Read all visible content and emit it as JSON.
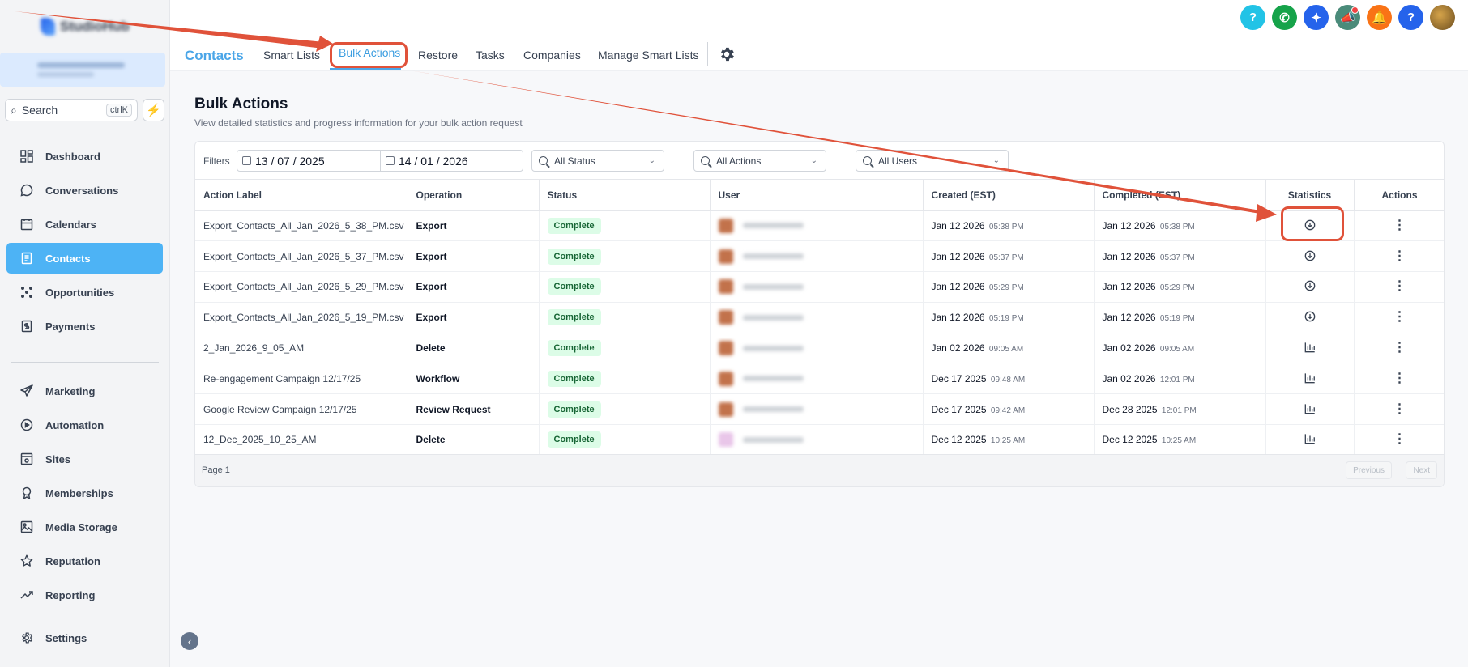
{
  "sidebar": {
    "logo_text": "StudioHub",
    "search": {
      "label": "Search",
      "shortcut": "ctrlK"
    },
    "items": [
      {
        "label": "Dashboard",
        "icon": "dashboard-icon"
      },
      {
        "label": "Conversations",
        "icon": "chat-icon"
      },
      {
        "label": "Calendars",
        "icon": "calendar-icon"
      },
      {
        "label": "Contacts",
        "icon": "contacts-icon",
        "active": true
      },
      {
        "label": "Opportunities",
        "icon": "opportunities-icon"
      },
      {
        "label": "Payments",
        "icon": "payments-icon"
      },
      {
        "label": "Marketing",
        "icon": "send-icon"
      },
      {
        "label": "Automation",
        "icon": "automation-icon"
      },
      {
        "label": "Sites",
        "icon": "sites-icon"
      },
      {
        "label": "Memberships",
        "icon": "award-icon"
      },
      {
        "label": "Media Storage",
        "icon": "image-icon"
      },
      {
        "label": "Reputation",
        "icon": "star-icon"
      },
      {
        "label": "Reporting",
        "icon": "trend-icon"
      },
      {
        "label": "Settings",
        "icon": "gear-icon"
      }
    ]
  },
  "topbar": {
    "icons": [
      {
        "name": "help-icon",
        "glyph": "?",
        "color": "#22c3e6"
      },
      {
        "name": "phone-icon",
        "glyph": "✆",
        "color": "#16a34a"
      },
      {
        "name": "sparkle-icon",
        "glyph": "✦",
        "color": "#2563eb"
      },
      {
        "name": "megaphone-icon",
        "glyph": "📣",
        "color": "#4b8b7a"
      },
      {
        "name": "bell-icon",
        "glyph": "🔔",
        "color": "#f97316"
      },
      {
        "name": "question-icon",
        "glyph": "?",
        "color": "#2563eb"
      }
    ]
  },
  "tabs": {
    "section": "Contacts",
    "items": [
      "Smart Lists",
      "Bulk Actions",
      "Restore",
      "Tasks",
      "Companies",
      "Manage Smart Lists"
    ],
    "active": "Bulk Actions"
  },
  "page": {
    "title": "Bulk Actions",
    "subtitle": "View detailed statistics and progress information for your bulk action request"
  },
  "filters": {
    "label": "Filters",
    "date_from": "13 / 07 / 2025",
    "date_to": "14 / 01 / 2026",
    "status": "All Status",
    "actions": "All Actions",
    "users": "All Users"
  },
  "table": {
    "columns": [
      "Action Label",
      "Operation",
      "Status",
      "User",
      "Created (EST)",
      "Completed (EST)",
      "Statistics",
      "Actions"
    ],
    "rows": [
      {
        "label": "Export_Contacts_All_Jan_2026_5_38_PM.csv",
        "operation": "Export",
        "status": "Complete",
        "created_date": "Jan 12 2026",
        "created_time": "05:38 PM",
        "completed_date": "Jan 12 2026",
        "completed_time": "05:38 PM",
        "stat": "download-icon"
      },
      {
        "label": "Export_Contacts_All_Jan_2026_5_37_PM.csv",
        "operation": "Export",
        "status": "Complete",
        "created_date": "Jan 12 2026",
        "created_time": "05:37 PM",
        "completed_date": "Jan 12 2026",
        "completed_time": "05:37 PM",
        "stat": "download-icon"
      },
      {
        "label": "Export_Contacts_All_Jan_2026_5_29_PM.csv",
        "operation": "Export",
        "status": "Complete",
        "created_date": "Jan 12 2026",
        "created_time": "05:29 PM",
        "completed_date": "Jan 12 2026",
        "completed_time": "05:29 PM",
        "stat": "download-icon"
      },
      {
        "label": "Export_Contacts_All_Jan_2026_5_19_PM.csv",
        "operation": "Export",
        "status": "Complete",
        "created_date": "Jan 12 2026",
        "created_time": "05:19 PM",
        "completed_date": "Jan 12 2026",
        "completed_time": "05:19 PM",
        "stat": "download-icon"
      },
      {
        "label": "2_Jan_2026_9_05_AM",
        "operation": "Delete",
        "status": "Complete",
        "created_date": "Jan 02 2026",
        "created_time": "09:05 AM",
        "completed_date": "Jan 02 2026",
        "completed_time": "09:05 AM",
        "stat": "bar-chart-icon"
      },
      {
        "label": "Re-engagement Campaign 12/17/25",
        "operation": "Workflow",
        "status": "Complete",
        "created_date": "Dec 17 2025",
        "created_time": "09:48 AM",
        "completed_date": "Jan 02 2026",
        "completed_time": "12:01 PM",
        "stat": "bar-chart-icon"
      },
      {
        "label": "Google Review Campaign 12/17/25",
        "operation": "Review Request",
        "status": "Complete",
        "created_date": "Dec 17 2025",
        "created_time": "09:42 AM",
        "completed_date": "Dec 28 2025",
        "completed_time": "12:01 PM",
        "stat": "bar-chart-icon"
      },
      {
        "label": "12_Dec_2025_10_25_AM",
        "operation": "Delete",
        "status": "Complete",
        "created_date": "Dec 12 2025",
        "created_time": "10:25 AM",
        "completed_date": "Dec 12 2025",
        "completed_time": "10:25 AM",
        "stat": "bar-chart-icon"
      }
    ]
  },
  "pager": {
    "label": "Page 1",
    "prev": "Previous",
    "next": "Next"
  },
  "colors": {
    "accent": "#4db3f5",
    "annotation": "#e0523a",
    "badge_bg": "#dcfce7"
  }
}
